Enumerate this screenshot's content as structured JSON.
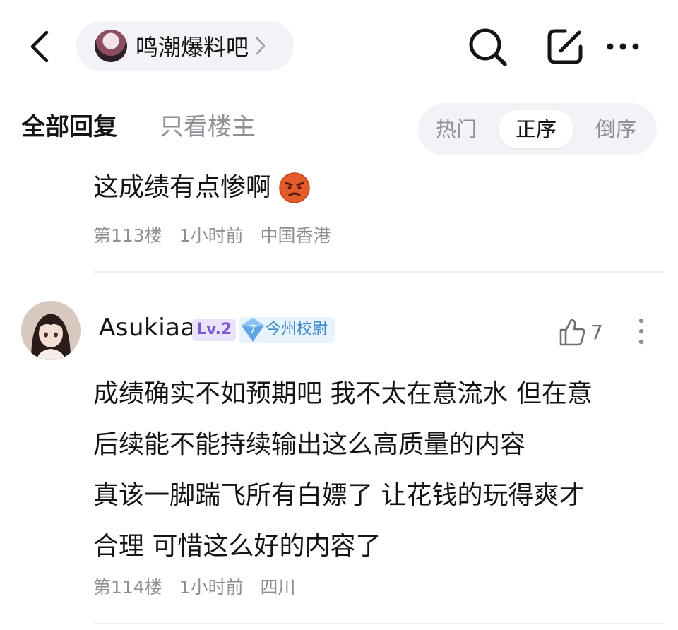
{
  "header": {
    "forum_name": "鸣潮爆料吧"
  },
  "tabs": {
    "all_replies": "全部回复",
    "op_only": "只看楼主",
    "sort": {
      "hot": "热门",
      "ascending": "正序",
      "descending": "倒序",
      "selected": "正序"
    }
  },
  "posts": [
    {
      "text": "这成绩有点惨啊",
      "emoji": "angry-face-icon",
      "floor": "第113楼",
      "time": "1小时前",
      "location": "中国香港"
    },
    {
      "username": "Asukiaa",
      "level": "Lv.2",
      "title_rank": "7",
      "title": "今州校尉",
      "likes": "7",
      "lines": [
        "成绩确实不如预期吧 我不太在意流水 但在意",
        "后续能不能持续输出这么高质量的内容",
        "真该一脚踹飞所有白嫖了 让花钱的玩得爽才",
        "合理 可惜这么好的内容了"
      ],
      "floor": "第114楼",
      "time": "1小时前",
      "location": "四川"
    }
  ],
  "colors": {
    "text": "#141414",
    "muted": "#8e8e95",
    "pill_bg": "#f3f3f7",
    "level": "#7c5ad6",
    "title_badge": "#3d87c9"
  }
}
